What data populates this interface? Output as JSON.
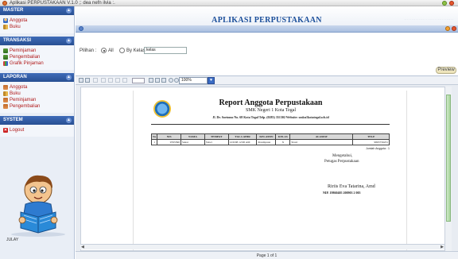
{
  "window": {
    "title": "Aplikasi PERPUSTAKAAN V.1.0 ;: dea nefn ilvia :."
  },
  "sidebar": {
    "master": {
      "title": "MASTER",
      "items": [
        {
          "label": "Anggota"
        },
        {
          "label": "Buku"
        }
      ]
    },
    "transaksi": {
      "title": "TRANSAKSI",
      "items": [
        {
          "label": "Peminjaman"
        },
        {
          "label": "Pengembalian"
        },
        {
          "label": "Grafik Pinjaman"
        }
      ]
    },
    "laporan": {
      "title": "LAPORAN",
      "items": [
        {
          "label": "Anggota"
        },
        {
          "label": "Buku"
        },
        {
          "label": "Peminjaman"
        },
        {
          "label": "Pengembalian"
        }
      ]
    },
    "system": {
      "title": "SYSTEM",
      "items": [
        {
          "label": "Logout"
        }
      ]
    },
    "illustration_caption": "JULAY"
  },
  "header": {
    "app_title": "APLIKASI PERPUSTAKAAN"
  },
  "filter": {
    "label": "Pilihan :",
    "option_all": "All",
    "option_kelas": "By Kelas",
    "kelas_value": "kelas"
  },
  "preview_label": "Preview",
  "report_toolbar": {
    "zoom": "100%"
  },
  "report": {
    "title": "Report Anggota Perpustakaan",
    "school": "SMK Negeri 1 Kota Tegal",
    "address": "Jl. Dr. Soetomo No. 68 Kota Tegal Telp. (0283) 351302 Website: smkn1kotategal.sch.id",
    "columns": [
      "No",
      "NIS",
      "NAMA",
      "TEMPAT",
      "TGL LAHIR",
      "KELAMIN",
      "KELAS",
      "ALAMAT",
      "TELP"
    ],
    "rows": [
      [
        "1",
        "9765390",
        "Sekar",
        "Slawi",
        "12/6/98 12:00 AM",
        "Perempuan",
        "X",
        "Slawi",
        "9865756231"
      ]
    ],
    "jumlah": "Jumlah Anggota : 1",
    "sign_line1": "Mengetahui,",
    "sign_line2": "Petugas Perpustakaan",
    "sign_name": "Ririis Eva Tatarina, Amd",
    "sign_nip": "NIP. 19860405 200903 2 005"
  },
  "pager": "Page 1 of 1"
}
